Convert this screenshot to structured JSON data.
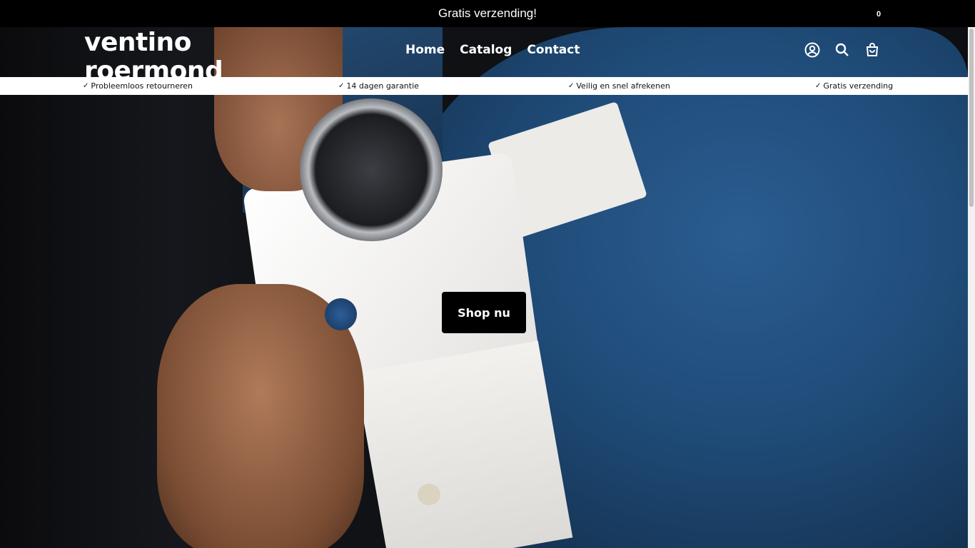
{
  "announcement": {
    "text": "Gratis verzending!"
  },
  "header": {
    "logo": "ventino roermond",
    "nav": [
      {
        "label": "Home"
      },
      {
        "label": "Catalog"
      },
      {
        "label": "Contact"
      }
    ],
    "cart_count": "0",
    "icons": [
      "account-icon",
      "search-icon",
      "cart-icon"
    ]
  },
  "usp": [
    {
      "label": "Probleemloos retourneren"
    },
    {
      "label": "14 dagen garantie"
    },
    {
      "label": "Veilig en snel afrekenen"
    },
    {
      "label": "Gratis verzending"
    }
  ],
  "hero": {
    "button_label": "Shop nu"
  },
  "colors": {
    "bar": "#000000",
    "usp_bg": "#ffffff",
    "suit": "#1f4f7f",
    "shirt": "#f4f2ef"
  }
}
